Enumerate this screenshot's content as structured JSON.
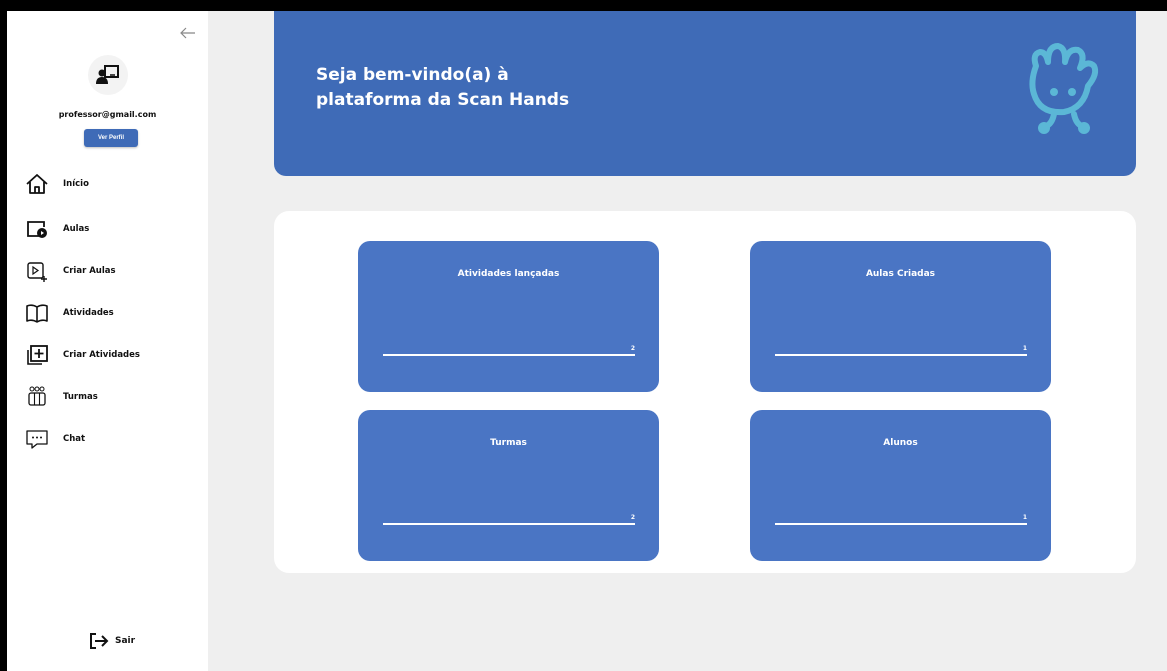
{
  "sidebar": {
    "email": "professor@gmail.com",
    "profile_button": "Ver Perfil",
    "items": [
      {
        "label": "Início",
        "icon": "home-icon"
      },
      {
        "label": "Aulas",
        "icon": "video-lessons-icon"
      },
      {
        "label": "Criar Aulas",
        "icon": "create-video-icon"
      },
      {
        "label": "Atividades",
        "icon": "book-icon"
      },
      {
        "label": "Criar Atividades",
        "icon": "add-box-icon"
      },
      {
        "label": "Turmas",
        "icon": "classes-icon"
      },
      {
        "label": "Chat",
        "icon": "chat-icon"
      }
    ],
    "logout_label": "Sair"
  },
  "banner": {
    "line1": "Seja bem-vindo(a) à",
    "line2": "plataforma da Scan Hands"
  },
  "cards": [
    {
      "title": "Atividades lançadas",
      "count": "2"
    },
    {
      "title": "Aulas Criadas",
      "count": "1"
    },
    {
      "title": "Turmas",
      "count": "2"
    },
    {
      "title": "Alunos",
      "count": "1"
    }
  ],
  "colors": {
    "primary": "#3f6bb7",
    "card": "#4a75c4",
    "mascot": "#5bb7d6",
    "background": "#efefef"
  }
}
